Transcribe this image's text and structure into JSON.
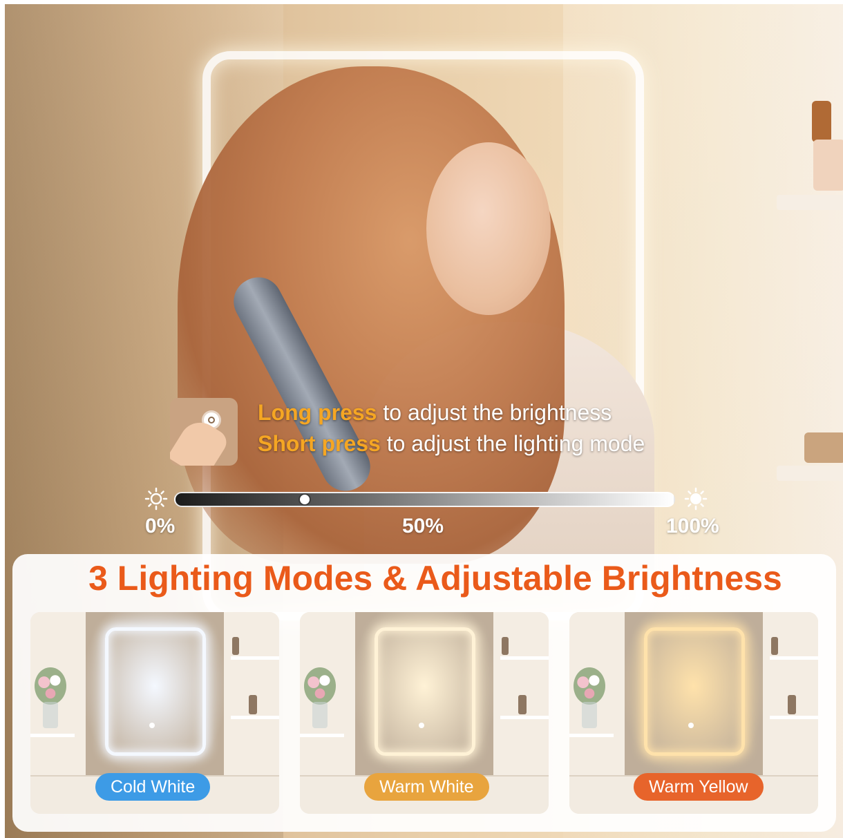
{
  "instructions": {
    "long_press": "Long press",
    "long_press_rest": " to adjust the brightness",
    "short_press": "Short press",
    "short_press_rest": " to adjust the lighting mode"
  },
  "brightness": {
    "value_percent": 26,
    "ticks": [
      "0%",
      "50%",
      "100%"
    ]
  },
  "title": "3 Lighting Modes & Adjustable Brightness",
  "modes": [
    {
      "label": "Cold White",
      "color": "#3d9be6",
      "light": "#f4f8ff"
    },
    {
      "label": "Warm White",
      "color": "#e8a43e",
      "light": "#fff2d6"
    },
    {
      "label": "Warm Yellow",
      "color": "#e7642b",
      "light": "#ffe2ab"
    }
  ],
  "colors": {
    "highlight": "#f5a623",
    "title": "#ea5a1a"
  }
}
